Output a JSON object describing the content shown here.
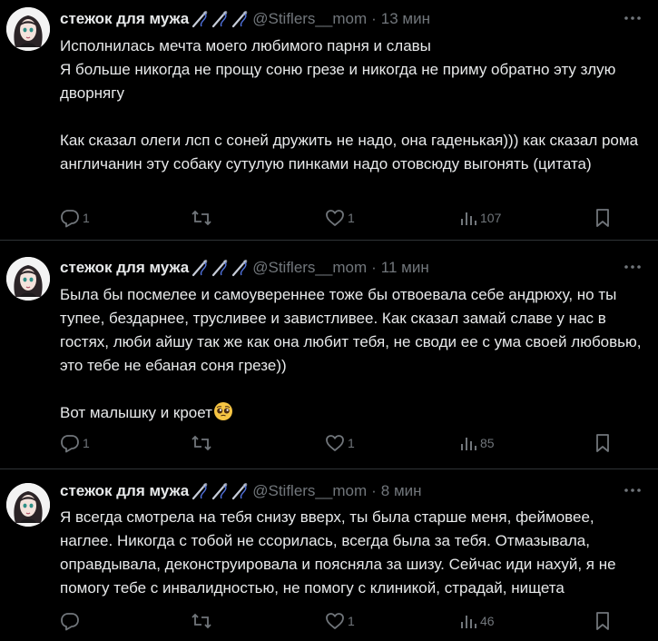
{
  "colors": {
    "background": "#000000",
    "text": "#e7e9ea",
    "muted": "#71767b",
    "divider": "#2f3336"
  },
  "tweets": [
    {
      "author": {
        "name": "стежок для мужа",
        "handle": "@Stiflers__mom",
        "badge_icon": "sewing-needle-icon"
      },
      "time": "13 мин",
      "lines": [
        "Исполнилась мечта моего любимого парня и славы",
        "Я больше никогда не прощу соню грезе и никогда не приму обратно эту злую дворнягу",
        "",
        "Как сказал олеги лсп с соней дружить не надо, она гаденькая))) как сказал рома англичанин эту собаку сутулую пинками надо отовсюду выгонять (цитата)"
      ],
      "stats": {
        "replies": "1",
        "reposts": "",
        "likes": "1",
        "views": "107"
      }
    },
    {
      "author": {
        "name": "стежок для мужа",
        "handle": "@Stiflers__mom",
        "badge_icon": "sewing-needle-icon"
      },
      "time": "11 мин",
      "lines": [
        "Была бы посмелее и самоувереннее тоже бы отвоевала себе андрюху, но ты тупее, бездарнее, трусливее и завистливее. Как сказал замай славе у нас в гостях, люби айшу так же как она любит тебя, не своди ее с ума своей любовью, это тебе не ебаная соня грезе))",
        "",
        "Вот малышку и кроет"
      ],
      "emoji": "pleading-face-emoji",
      "stats": {
        "replies": "1",
        "reposts": "",
        "likes": "1",
        "views": "85"
      }
    },
    {
      "author": {
        "name": "стежок для мужа",
        "handle": "@Stiflers__mom",
        "badge_icon": "sewing-needle-icon"
      },
      "time": "8 мин",
      "lines": [
        "Я всегда смотрела на тебя снизу вверх, ты была старше меня, феймовее, наглее. Никогда с тобой не ссорилась, всегда была за тебя. Отмазывала, оправдывала, деконструировала и поясняла за шизу. Сейчас иди нахуй, я не помогу тебе с инвалидностью, не помогу с клиникой, страдай, нищета"
      ],
      "stats": {
        "replies": "",
        "reposts": "",
        "likes": "1",
        "views": "46"
      }
    }
  ]
}
